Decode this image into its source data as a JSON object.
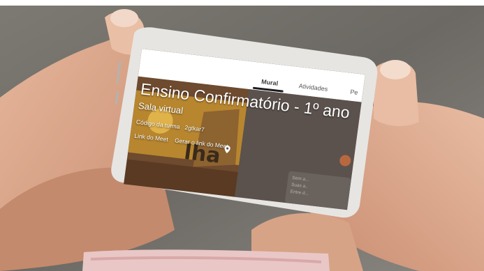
{
  "tabs": [
    {
      "label": "Mural",
      "active": true
    },
    {
      "label": "Atividades",
      "active": false
    },
    {
      "label": "Pe",
      "active": false
    }
  ],
  "class": {
    "title": "Ensino Confirmatório - 1º ano",
    "subtitle": "Sala virtual",
    "code_label": "Código da turma",
    "code_value": "2gtkar7",
    "meet_label": "Link do Meet",
    "meet_action": "Gerar o link do Meet"
  },
  "side_card_lines": [
    "Sem a...",
    "Suas a..",
    "Entre d..."
  ],
  "colors": {
    "banner_dark": "#5b524d",
    "banner_accent": "#d9a441",
    "underline": "#1b1b1b"
  }
}
